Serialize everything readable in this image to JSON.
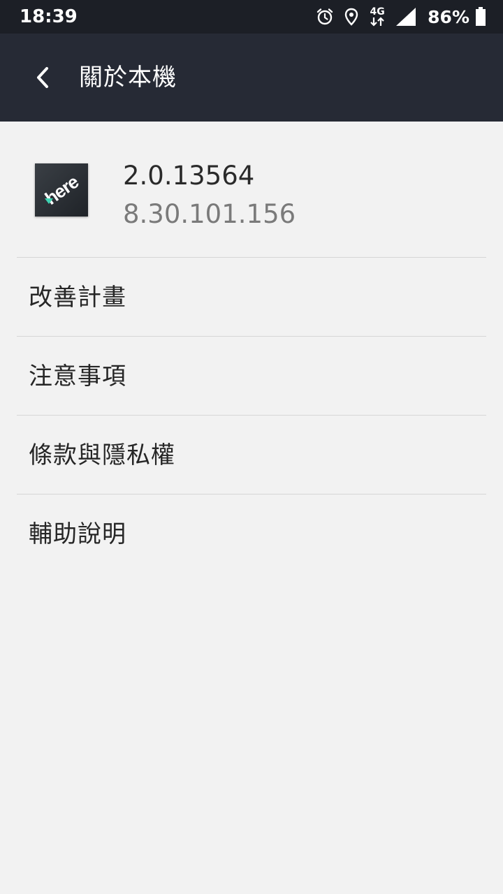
{
  "status_bar": {
    "time": "18:39",
    "network_type": "4G",
    "battery_percent": "86%",
    "icons": [
      "alarm-icon",
      "location-icon",
      "data-transfer-icon",
      "signal-icon",
      "battery-icon"
    ]
  },
  "app_bar": {
    "title": "關於本機",
    "back_icon": "chevron-left-icon"
  },
  "about": {
    "logo_text": "here",
    "version": "2.0.13564",
    "build": "8.30.101.156"
  },
  "menu": {
    "items": [
      {
        "label": "改善計畫"
      },
      {
        "label": "注意事項"
      },
      {
        "label": "條款與隱私權"
      },
      {
        "label": "輔助說明"
      }
    ]
  },
  "colors": {
    "status_bar_bg": "#1c1f26",
    "app_bar_bg": "#262a35",
    "page_bg": "#f2f2f2",
    "divider": "#d6d6d6",
    "logo_accent": "#3fd5b4"
  }
}
